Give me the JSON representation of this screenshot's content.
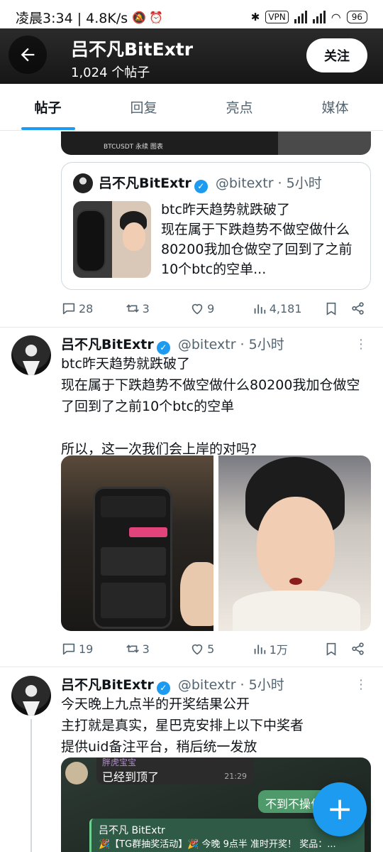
{
  "status_bar": {
    "time_speed": "凌晨3:34 | 4.8K/s",
    "vpn": "VPN",
    "battery": "96"
  },
  "header": {
    "name": "吕不凡BitExtr",
    "post_count": "1,024 个帖子",
    "follow_label": "关注"
  },
  "tabs": [
    {
      "label": "帖子"
    },
    {
      "label": "回复"
    },
    {
      "label": "亮点"
    },
    {
      "label": "媒体"
    }
  ],
  "first_post": {
    "image_caption": "BTCUSDT 永续 图表",
    "quote": {
      "name": "吕不凡BitExtr",
      "handle": "@bitextr · 5小时",
      "text": "btc昨天趋势就跌破了\n现在属于下跌趋势不做空做什么80200我加仓做空了回到了之前10个btc的空单..."
    },
    "actions": {
      "replies": "28",
      "retweets": "3",
      "likes": "9",
      "views": "4,181"
    }
  },
  "second_post": {
    "name": "吕不凡BitExtr",
    "handle": "@bitextr · 5小时",
    "text": "btc昨天趋势就跌破了\n现在属于下跌趋势不做空做什么80200我加仓做空了回到了之前10个btc的空单\n\n所以，这一次我们会上岸的对吗?",
    "actions": {
      "replies": "19",
      "retweets": "3",
      "likes": "5",
      "views": "1万"
    }
  },
  "third_post": {
    "name": "吕不凡BitExtr",
    "handle": "@bitextr · 5小时",
    "text": "今天晚上九点半的开奖结果公开\n主打就是真实，星巴克安排上以下中奖者\n提供uid备注平台，稍后统一发放",
    "chat": {
      "sender_top": "胖虎宝宝",
      "msg1": "已经到顶了",
      "time1": "21:29",
      "bubble_right": "不到不操作",
      "card_name": "吕不凡 BitExtr",
      "card_text": "🎉【TG群抽奖活动】🎉 今晚 9点半 准时开奖！ 奖品：..."
    }
  },
  "icons": {
    "back": "arrow-left-icon",
    "verified": "verified-badge-icon",
    "reply": "comment-icon",
    "retweet": "retweet-icon",
    "like": "heart-icon",
    "views": "bar-chart-icon",
    "bookmark": "bookmark-icon",
    "share": "share-icon",
    "fab": "plus-icon"
  },
  "colors": {
    "accent": "#1d9bf0",
    "text": "#0f1419",
    "muted": "#536471"
  }
}
